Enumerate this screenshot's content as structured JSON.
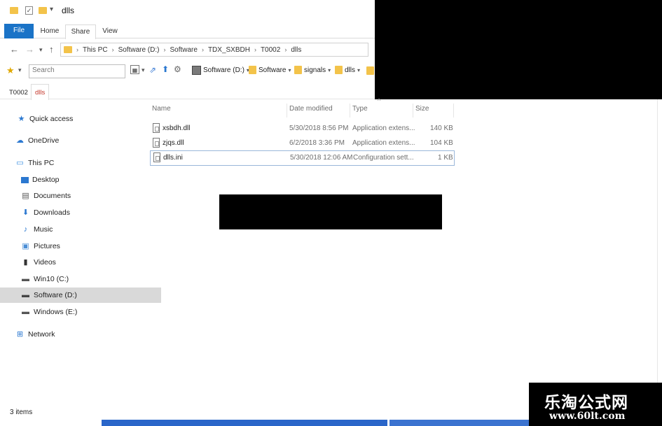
{
  "window": {
    "title": "dlls"
  },
  "ribbon": {
    "tabs": [
      "File",
      "Home",
      "Share",
      "View"
    ]
  },
  "address": {
    "crumbs": [
      "This PC",
      "Software (D:)",
      "Software",
      "TDX_SXBDH",
      "T0002",
      "dlls"
    ]
  },
  "search": {
    "placeholder": "Search"
  },
  "toolbar_links": [
    "Software (D:)",
    "Software",
    "signals",
    "dlls"
  ],
  "subtabs": [
    "T0002",
    "dlls"
  ],
  "nav_pane": [
    {
      "label": "Quick access",
      "icon": "star-icon"
    },
    {
      "label": "OneDrive",
      "icon": "cloud-icon"
    },
    {
      "label": "This PC",
      "icon": "computer-icon"
    },
    {
      "label": "Desktop",
      "icon": "desktop-icon"
    },
    {
      "label": "Documents",
      "icon": "documents-icon"
    },
    {
      "label": "Downloads",
      "icon": "download-icon"
    },
    {
      "label": "Music",
      "icon": "music-icon"
    },
    {
      "label": "Pictures",
      "icon": "pictures-icon"
    },
    {
      "label": "Videos",
      "icon": "videos-icon"
    },
    {
      "label": "Win10 (C:)",
      "icon": "drive-icon"
    },
    {
      "label": "Software (D:)",
      "icon": "drive-icon"
    },
    {
      "label": "Windows (E:)",
      "icon": "drive-icon"
    },
    {
      "label": "Network",
      "icon": "network-icon"
    }
  ],
  "columns": {
    "name": "Name",
    "date": "Date modified",
    "type": "Type",
    "size": "Size"
  },
  "files": [
    {
      "name": "xsbdh.dll",
      "date": "5/30/2018 8:56 PM",
      "type": "Application extens...",
      "size": "140 KB"
    },
    {
      "name": "zjqs.dll",
      "date": "6/2/2018 3:36 PM",
      "type": "Application extens...",
      "size": "104 KB"
    },
    {
      "name": "dlls.ini",
      "date": "5/30/2018 12:06 AM",
      "type": "Configuration sett...",
      "size": "1 KB"
    }
  ],
  "status": {
    "items": "3 items"
  },
  "watermark": {
    "cn": "乐淘公式网",
    "url": "www.60lt.com"
  }
}
